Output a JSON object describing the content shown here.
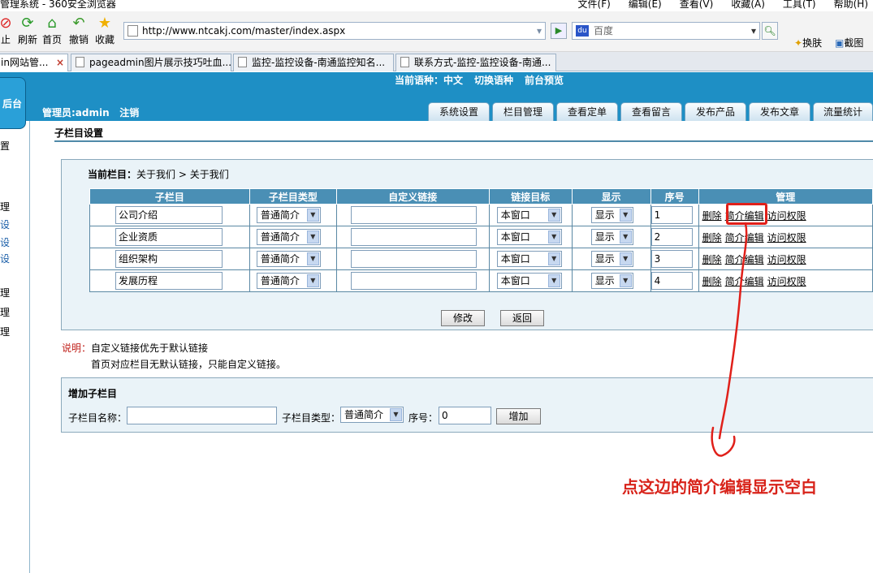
{
  "browser": {
    "title": "管理系统 - 360安全浏览器",
    "menu": [
      "文件(F)",
      "编辑(E)",
      "查看(V)",
      "收藏(A)",
      "工具(T)",
      "帮助(H)"
    ],
    "toolbar": [
      {
        "label": "止",
        "icon": "stop-icon"
      },
      {
        "label": "刷新",
        "icon": "refresh-icon"
      },
      {
        "label": "首页",
        "icon": "home-icon"
      },
      {
        "label": "撤销",
        "icon": "undo-icon"
      },
      {
        "label": "收藏",
        "icon": "star-icon"
      }
    ],
    "address": "http://www.ntcakj.com/master/index.aspx",
    "search_placeholder": "百度",
    "right_tools": [
      "换肤",
      "截图"
    ],
    "tabs": [
      "in网站管...",
      "pageadmin图片展示技巧吐血...",
      "监控-监控设备-南通监控知名...",
      "联系方式-监控-监控设备-南通..."
    ]
  },
  "header": {
    "lang": [
      "当前语种：中文",
      "切换语种",
      "前台预览"
    ],
    "admin": "管理员:admin",
    "logout": "注销",
    "side_button": "后台",
    "nav_tabs": [
      "系统设置",
      "栏目管理",
      "查看定单",
      "查看留言",
      "发布产品",
      "发布文章",
      "流量统计"
    ]
  },
  "sidebar_fragments": [
    "置",
    "理",
    "设",
    "设",
    "设",
    "理",
    "理",
    "理"
  ],
  "section_title": "子栏目设置",
  "current_column": {
    "label": "当前栏目：",
    "path": "关于我们 > 关于我们"
  },
  "table": {
    "headers": [
      "子栏目",
      "子栏目类型",
      "自定义链接",
      "链接目标",
      "显示",
      "序号",
      "管理"
    ],
    "rows": [
      {
        "name": "公司介绍",
        "type": "普通简介",
        "link": "",
        "target": "本窗口",
        "show": "显示",
        "order": "1"
      },
      {
        "name": "企业资质",
        "type": "普通简介",
        "link": "",
        "target": "本窗口",
        "show": "显示",
        "order": "2"
      },
      {
        "name": "组织架构",
        "type": "普通简介",
        "link": "",
        "target": "本窗口",
        "show": "显示",
        "order": "3"
      },
      {
        "name": "发展历程",
        "type": "普通简介",
        "link": "",
        "target": "本窗口",
        "show": "显示",
        "order": "4"
      }
    ],
    "actions": [
      "删除",
      "简介编辑",
      "访问权限"
    ]
  },
  "buttons": {
    "modify": "修改",
    "back": "返回",
    "add": "增加"
  },
  "note": {
    "label": "说明：",
    "line1": "自定义链接优先于默认链接",
    "line2": "首页对应栏目无默认链接，只能自定义链接。"
  },
  "add_form": {
    "title": "增加子栏目",
    "name_label": "子栏目名称：",
    "type_label": "子栏目类型：",
    "type_value": "普通简介",
    "order_label": "序号：",
    "order_value": "0"
  },
  "annotation": "点这边的简介编辑显示空白"
}
